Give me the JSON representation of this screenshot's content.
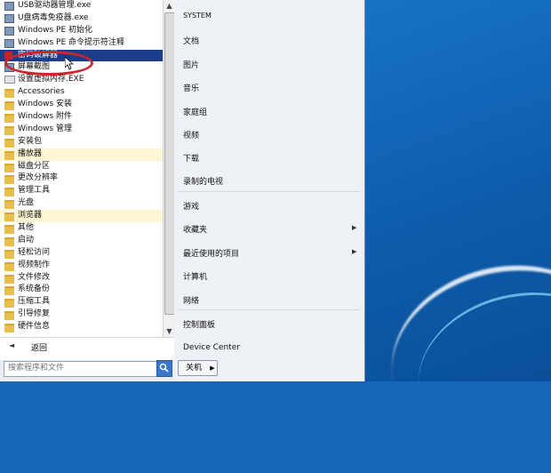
{
  "programs": [
    {
      "label": "USB驱动器管理.exe",
      "icon": "usb-icon",
      "state": ""
    },
    {
      "label": "U盘病毒免疫器.exe",
      "icon": "shield-icon",
      "state": ""
    },
    {
      "label": "Windows PE 初始化",
      "icon": "monitor-icon",
      "state": ""
    },
    {
      "label": "Windows PE 命令提示符注释",
      "icon": "console-icon",
      "state": ""
    },
    {
      "label": "密码破解器",
      "icon": "lock-icon",
      "state": "selected"
    },
    {
      "label": "屏幕截图",
      "icon": "screen-icon",
      "state": ""
    },
    {
      "label": "设置虚拟内存.EXE",
      "icon": "disk-icon",
      "state": ""
    },
    {
      "label": "Accessories",
      "icon": "folder-icon",
      "state": ""
    },
    {
      "label": "Windows 安装",
      "icon": "folder-icon",
      "state": ""
    },
    {
      "label": "Windows 附件",
      "icon": "folder-icon",
      "state": ""
    },
    {
      "label": "Windows 管理",
      "icon": "folder-icon",
      "state": ""
    },
    {
      "label": "安装包",
      "icon": "folder-icon",
      "state": ""
    },
    {
      "label": "播放器",
      "icon": "folder-icon",
      "state": "highlight"
    },
    {
      "label": "磁盘分区",
      "icon": "folder-icon",
      "state": ""
    },
    {
      "label": "更改分辨率",
      "icon": "folder-icon",
      "state": ""
    },
    {
      "label": "管理工具",
      "icon": "folder-icon",
      "state": ""
    },
    {
      "label": "光盘",
      "icon": "folder-icon",
      "state": ""
    },
    {
      "label": "浏览器",
      "icon": "folder-icon",
      "state": "highlight"
    },
    {
      "label": "其他",
      "icon": "folder-icon",
      "state": ""
    },
    {
      "label": "启动",
      "icon": "folder-icon",
      "state": ""
    },
    {
      "label": "轻松访问",
      "icon": "folder-icon",
      "state": ""
    },
    {
      "label": "视频制作",
      "icon": "folder-icon",
      "state": ""
    },
    {
      "label": "文件修改",
      "icon": "folder-icon",
      "state": ""
    },
    {
      "label": "系统备份",
      "icon": "folder-icon",
      "state": ""
    },
    {
      "label": "压缩工具",
      "icon": "folder-icon",
      "state": ""
    },
    {
      "label": "引导修复",
      "icon": "folder-icon",
      "state": ""
    },
    {
      "label": "硬件信息",
      "icon": "folder-icon",
      "state": ""
    }
  ],
  "back": {
    "label": "返回"
  },
  "search": {
    "placeholder": "搜索程序和文件"
  },
  "right_menu": {
    "system": "SYSTEM",
    "documents": "文档",
    "pictures": "图片",
    "music": "音乐",
    "homegroup": "家庭组",
    "videos": "视频",
    "downloads": "下载",
    "recorded_tv": "录制的电视",
    "games": "游戏",
    "favorites": "收藏夹",
    "recent_items": "最近使用的项目",
    "computer": "计算机",
    "network": "网络",
    "control_panel": "控制面板",
    "device_center": "Device Center"
  },
  "shutdown": {
    "label": "关机"
  },
  "colors": {
    "selected": "#1b3d8a",
    "highlight": "#fdf6d3",
    "annotation": "#d0232a"
  }
}
